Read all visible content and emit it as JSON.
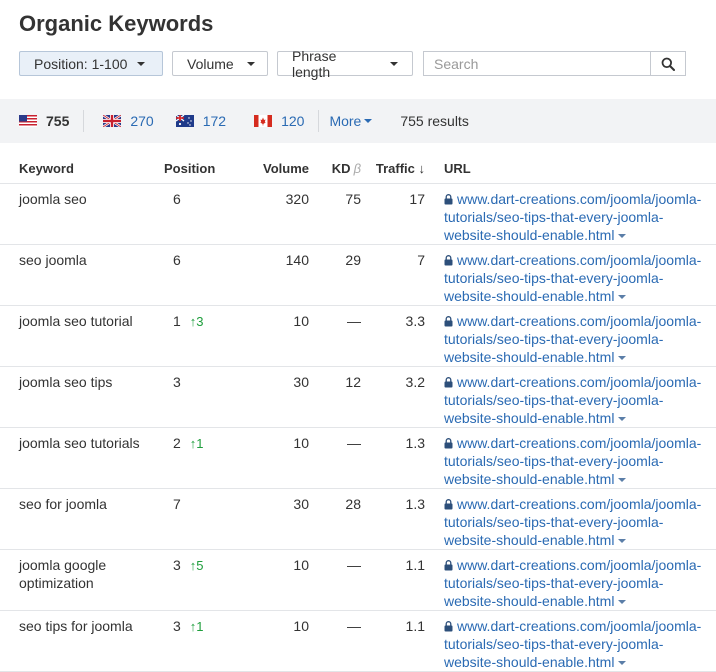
{
  "page": {
    "title": "Organic Keywords"
  },
  "filters": {
    "position_label": "Position: 1-100",
    "volume_label": "Volume",
    "phrase_label": "Phrase length",
    "search_placeholder": "Search"
  },
  "countries": [
    {
      "code": "US",
      "count": "755"
    },
    {
      "code": "UK",
      "count": "270"
    },
    {
      "code": "AU",
      "count": "172"
    },
    {
      "code": "CA",
      "count": "120"
    }
  ],
  "more_label": "More",
  "results_text": "755 results",
  "table": {
    "headers": {
      "keyword": "Keyword",
      "position": "Position",
      "volume": "Volume",
      "kd": "KD",
      "kd_beta": "β",
      "traffic": "Traffic ↓",
      "url": "URL"
    },
    "rows": [
      {
        "keyword": "joomla seo",
        "position": "6",
        "delta": "",
        "volume": "320",
        "kd": "75",
        "traffic": "17",
        "url": "www.dart-creations.com/joomla/joomla-tutorials/seo-tips-that-every-joomla-website-should-enable.html"
      },
      {
        "keyword": "seo joomla",
        "position": "6",
        "delta": "",
        "volume": "140",
        "kd": "29",
        "traffic": "7",
        "url": "www.dart-creations.com/joomla/joomla-tutorials/seo-tips-that-every-joomla-website-should-enable.html"
      },
      {
        "keyword": "joomla seo tutorial",
        "position": "1",
        "delta": "↑3",
        "volume": "10",
        "kd": "—",
        "traffic": "3.3",
        "url": "www.dart-creations.com/joomla/joomla-tutorials/seo-tips-that-every-joomla-website-should-enable.html"
      },
      {
        "keyword": "joomla seo tips",
        "position": "3",
        "delta": "",
        "volume": "30",
        "kd": "12",
        "traffic": "3.2",
        "url": "www.dart-creations.com/joomla/joomla-tutorials/seo-tips-that-every-joomla-website-should-enable.html"
      },
      {
        "keyword": "joomla seo tutorials",
        "position": "2",
        "delta": "↑1",
        "volume": "10",
        "kd": "—",
        "traffic": "1.3",
        "url": "www.dart-creations.com/joomla/joomla-tutorials/seo-tips-that-every-joomla-website-should-enable.html"
      },
      {
        "keyword": "seo for joomla",
        "position": "7",
        "delta": "",
        "volume": "30",
        "kd": "28",
        "traffic": "1.3",
        "url": "www.dart-creations.com/joomla/joomla-tutorials/seo-tips-that-every-joomla-website-should-enable.html"
      },
      {
        "keyword": "joomla google optimization",
        "position": "3",
        "delta": "↑5",
        "volume": "10",
        "kd": "—",
        "traffic": "1.1",
        "url": "www.dart-creations.com/joomla/joomla-tutorials/seo-tips-that-every-joomla-website-should-enable.html"
      },
      {
        "keyword": "seo tips for joomla",
        "position": "3",
        "delta": "↑1",
        "volume": "10",
        "kd": "—",
        "traffic": "1.1",
        "url": "www.dart-creations.com/joomla/joomla-tutorials/seo-tips-that-every-joomla-website-should-enable.html"
      }
    ]
  },
  "colors": {
    "link": "#2a6ab3",
    "up": "#1e9e3c",
    "bar_bg": "#f2f3f5"
  },
  "icons": {
    "search": "search-icon",
    "lock": "lock-icon"
  }
}
